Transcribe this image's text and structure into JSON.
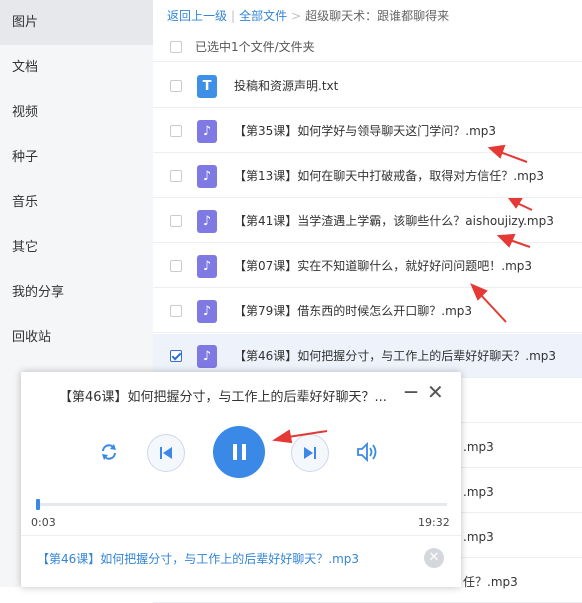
{
  "sidebar": {
    "items": [
      {
        "label": "图片"
      },
      {
        "label": "文档"
      },
      {
        "label": "视频"
      },
      {
        "label": "种子"
      },
      {
        "label": "音乐"
      },
      {
        "label": "其它"
      },
      {
        "label": "我的分享"
      },
      {
        "label": "回收站"
      }
    ]
  },
  "breadcrumb": {
    "back": "返回上一级",
    "separator": "|",
    "all": "全部文件",
    "arrow": ">",
    "current": "超级聊天术：跟谁都聊得来"
  },
  "selection": {
    "text": "已选中1个文件/文件夹"
  },
  "files": [
    {
      "name": "投稿和资源声明.txt",
      "icon": "txt-file-icon",
      "glyph": "T"
    },
    {
      "name": "【第35课】如何学好与领导聊天这门学问？.mp3",
      "icon": "audio-file-icon",
      "glyph": "♪"
    },
    {
      "name": "【第13课】如何在聊天中打破戒备，取得对方信任？.mp3",
      "icon": "audio-file-icon",
      "glyph": "♪"
    },
    {
      "name": "【第41课】当学渣遇上学霸，该聊些什么？aishoujizy.mp3",
      "icon": "audio-file-icon",
      "glyph": "♪"
    },
    {
      "name": "【第07课】实在不知道聊什么，就好好问问题吧！.mp3",
      "icon": "audio-file-icon",
      "glyph": "♪"
    },
    {
      "name": "【第79课】借东西的时候怎么开口聊？.mp3",
      "icon": "audio-file-icon",
      "glyph": "♪"
    },
    {
      "name": "【第46课】如何把握分寸，与工作上的后辈好好聊天？.mp3",
      "icon": "audio-file-icon",
      "glyph": "♪",
      "selected": true
    }
  ],
  "hidden_rows": [
    ".mp3",
    ".mp3",
    ".mp3",
    ".mp3",
    "任？.mp3"
  ],
  "player": {
    "title": "【第46课】如何把握分寸，与工作上的后辈好好聊天？...",
    "minimize": "—",
    "close": "✕",
    "current_time": "0:03",
    "total_time": "19:32",
    "progress": 0.003,
    "queue_item": "【第46课】如何把握分寸，与工作上的后辈好好聊天？.mp3",
    "queue_close": "✕"
  },
  "colors": {
    "accent": "#3b89e6",
    "link": "#3385d8",
    "annotation": "#e53935",
    "audio_icon": "#7f79e3"
  }
}
